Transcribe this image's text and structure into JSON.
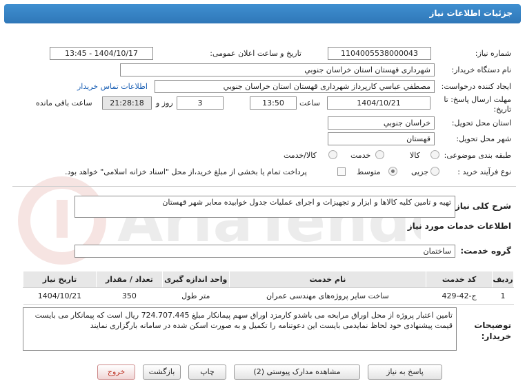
{
  "header": {
    "title": "جزئیات اطلاعات نیاز"
  },
  "form": {
    "need_number_label": "شماره نیاز:",
    "need_number": "1104005538000043",
    "announce_label": "تاریخ و ساعت اعلان عمومی:",
    "announce_value": "1404/10/17 - 13:45",
    "buyer_org_label": "نام دستگاه خریدار:",
    "buyer_org": "شهرداری قهستان استان خراسان جنوبي",
    "creator_label": "ایجاد کننده درخواست:",
    "creator": "مصطفي عباسي کارپرداز شهرداری قهستان استان خراسان جنوبي",
    "contact_link": "اطلاعات تماس خریدار",
    "deadline_label_1": "مهلت ارسال پاسخ: تا",
    "deadline_label_2": "تاریخ:",
    "deadline_date": "1404/10/21",
    "time_label": "ساعت",
    "deadline_time": "13:50",
    "days_value": "3",
    "days_label": "روز و",
    "remaining_time": "21:28:18",
    "remaining_label": "ساعت باقی مانده",
    "province_label": "استان محل تحویل:",
    "province": "خراسان جنوبي",
    "city_label": "شهر محل تحویل:",
    "city": "قهستان",
    "category_label": "طبقه بندی موضوعی:",
    "category_options": [
      "کالا",
      "خدمت",
      "کالا/خدمت"
    ],
    "process_label": "نوع فرآیند خرید :",
    "process_options": [
      "جزیی",
      "متوسط"
    ],
    "payment_text": "پرداخت تمام یا بخشی از مبلغ خرید،از محل \"اسناد خزانه اسلامی\" خواهد بود."
  },
  "summary": {
    "label": "شرح کلی نیاز:",
    "text": "تهیه و تامین کلیه کالاها و ابزار و تجهیزات و اجرای عملیات جدول خوابیده  معابر شهر قهستان"
  },
  "services": {
    "section_title": "اطلاعات خدمات مورد نیاز",
    "group_label": "گروه خدمت:",
    "group_value": "ساختمان",
    "columns": [
      "ردیف",
      "کد خدمت",
      "نام خدمت",
      "واحد اندازه گیری",
      "تعداد / مقدار",
      "تاریخ نیاز"
    ],
    "rows": [
      {
        "row": "1",
        "code": "ج-42-429",
        "name": "ساخت سایر پروژه‌های مهندسی عمران",
        "unit": "متر طول",
        "qty": "350",
        "date": "1404/10/21"
      }
    ]
  },
  "buyer_notes": {
    "label_1": "توضیحات",
    "label_2": "خریدار:",
    "text": "تامین اعتبار پروژه از محل اوراق مرابحه می باشدو کارمزد اوراق سهم پیمانکار مبلغ 724.707.445 ریال است که پیمانکار می بایست قیمت پیشنهادی خود لحاظ نمایدمی بایست این دعوتنامه را تکمیل و به صورت اسکن شده در سامانه بارگزاری نمایند"
  },
  "buttons": {
    "reply": "پاسخ به نیاز",
    "docs": "مشاهده مدارک پیوستی (2)",
    "print": "چاپ",
    "back": "بازگشت",
    "exit": "خروج"
  },
  "watermark_text": "AriaTender.net",
  "colors": {
    "header_bg": "#2f77b8",
    "link": "#1a5fb4",
    "exit_text": "#c0392b"
  }
}
